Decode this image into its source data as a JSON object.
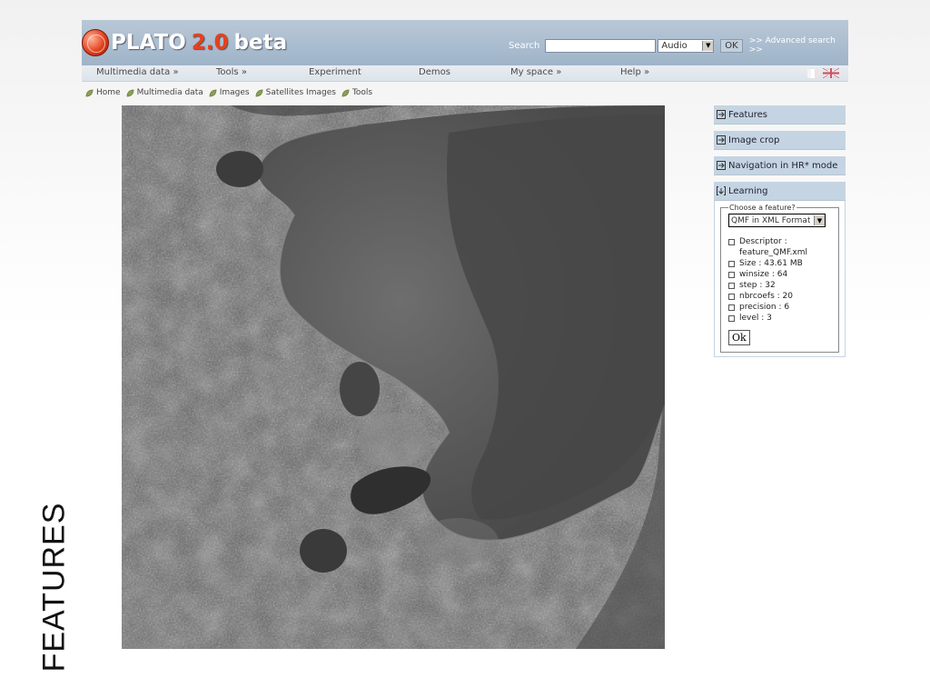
{
  "header": {
    "logo_name": "PLATO",
    "logo_version": "2.0",
    "logo_tag": "beta",
    "search_label": "Search",
    "search_value": "",
    "media_select": "Audio",
    "ok_label": "OK",
    "advanced_link": ">> Advanced search >>"
  },
  "nav": {
    "items": [
      "Multimedia data »",
      "Tools »",
      "Experiment",
      "Demos",
      "My space »",
      "Help »"
    ]
  },
  "breadcrumb": [
    "Home",
    "Multimedia data",
    "Images",
    "Satellites Images",
    "Tools"
  ],
  "panel": {
    "sections": [
      "Features",
      "Image crop",
      "Navigation in HR* mode",
      "Learning"
    ],
    "legend": "Choose a feature?",
    "selected_feature": "QMF in XML Format",
    "feature_details": [
      "Descriptor : feature_QMF.xml",
      "Size : 43.61 MB",
      "winsize : 64",
      "step : 32",
      "nbrcoefs : 20",
      "precision : 6",
      "level : 3"
    ],
    "submit_label": "Ok"
  },
  "side_label": "FEATURES",
  "colors": {
    "header": "#a9bccf",
    "accent": "#e5421d",
    "panel_head": "#c5d4e2"
  }
}
